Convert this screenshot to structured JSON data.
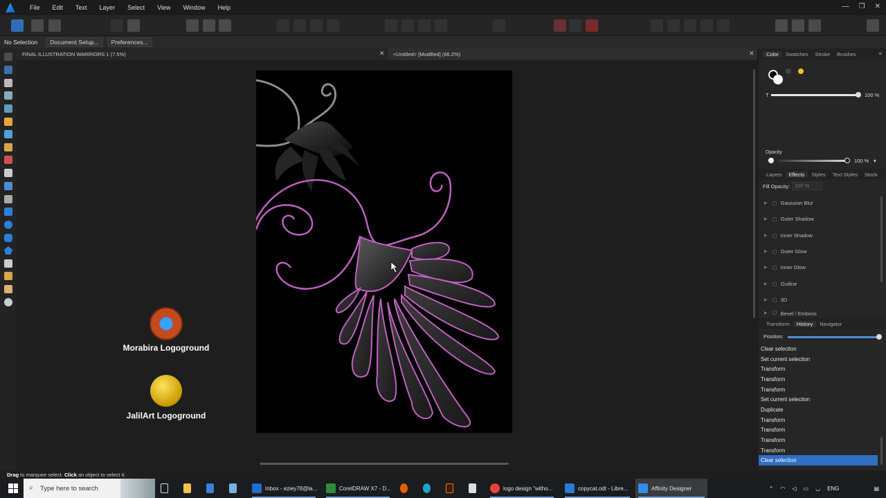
{
  "menu": {
    "items": [
      "File",
      "Edit",
      "Text",
      "Layer",
      "Select",
      "View",
      "Window",
      "Help"
    ]
  },
  "window_controls": {
    "minimize": "—",
    "restore": "❐",
    "close": "✕"
  },
  "context_bar": {
    "selection_label": "No Selection",
    "document_setup": "Document Setup...",
    "preferences": "Preferences..."
  },
  "doc_tabs": [
    {
      "title": "FINAL ILLUSTRATION WARRIORS 1 (7.5%)",
      "active": false
    },
    {
      "title": "<Untitled> [Modified] (66.2%)",
      "active": true
    }
  ],
  "canvas": {
    "logos": [
      {
        "name": "Morabira Logoground"
      },
      {
        "name": "JalilArt Logoground"
      }
    ],
    "morabira_letters": [
      "m",
      "o",
      "r",
      "a",
      "b",
      "i",
      "r",
      "a"
    ]
  },
  "status": {
    "drag": "Drag",
    "drag_text": " to marquee select. ",
    "click": "Click",
    "click_text": " an object to select it."
  },
  "color_panel": {
    "tabs": [
      "Color",
      "Swatches",
      "Stroke",
      "Brushes"
    ],
    "active_tab": "Color",
    "tint_label": "T",
    "tint_value": "100 %",
    "opacity_label": "Opacity",
    "opacity_value": "100 %",
    "accent": "#f5c21b"
  },
  "effects_panel": {
    "tabs": [
      "Layers",
      "Effects",
      "Styles",
      "Text Styles",
      "Stock"
    ],
    "active_tab": "Effects",
    "fill_opacity_label": "Fill Opacity:",
    "fill_opacity_value": "100 %",
    "effects": [
      "Gaussian Blur",
      "Outer Shadow",
      "Inner Shadow",
      "Outer Glow",
      "Inner Glow",
      "Outline",
      "3D",
      "Bevel / Emboss"
    ]
  },
  "history_panel": {
    "tabs": [
      "Transform",
      "History",
      "Navigator"
    ],
    "active_tab": "History",
    "position_label": "Position:",
    "entries": [
      "Clear selection",
      "Set current selection",
      "Transform",
      "Transform",
      "Transform",
      "Set current selection",
      "Duplicate",
      "Transform",
      "Transform",
      "Transform",
      "Transform",
      "Clear selection"
    ],
    "selected_index": 11,
    "selection_color": "#2f6ec2"
  },
  "taskbar": {
    "search_placeholder": "Type here to search",
    "apps": [
      {
        "label": "Inbox - eziey78@la...",
        "icon_color": "#1f6fd0"
      },
      {
        "label": "CorelDRAW X7 - D...",
        "icon_color": "#2e8b3a"
      },
      {
        "label": "logo design \"witho...",
        "icon_color": "#e94235"
      },
      {
        "label": "copycat.odt - Libre...",
        "icon_color": "#2a7bd6"
      },
      {
        "label": "Affinity Designer",
        "icon_color": "#2f8fe6"
      }
    ],
    "tray_lang": "ENG"
  },
  "colors": {
    "artwork_stroke": "#c060c0",
    "artwork_fill": "#2e2e2e"
  }
}
